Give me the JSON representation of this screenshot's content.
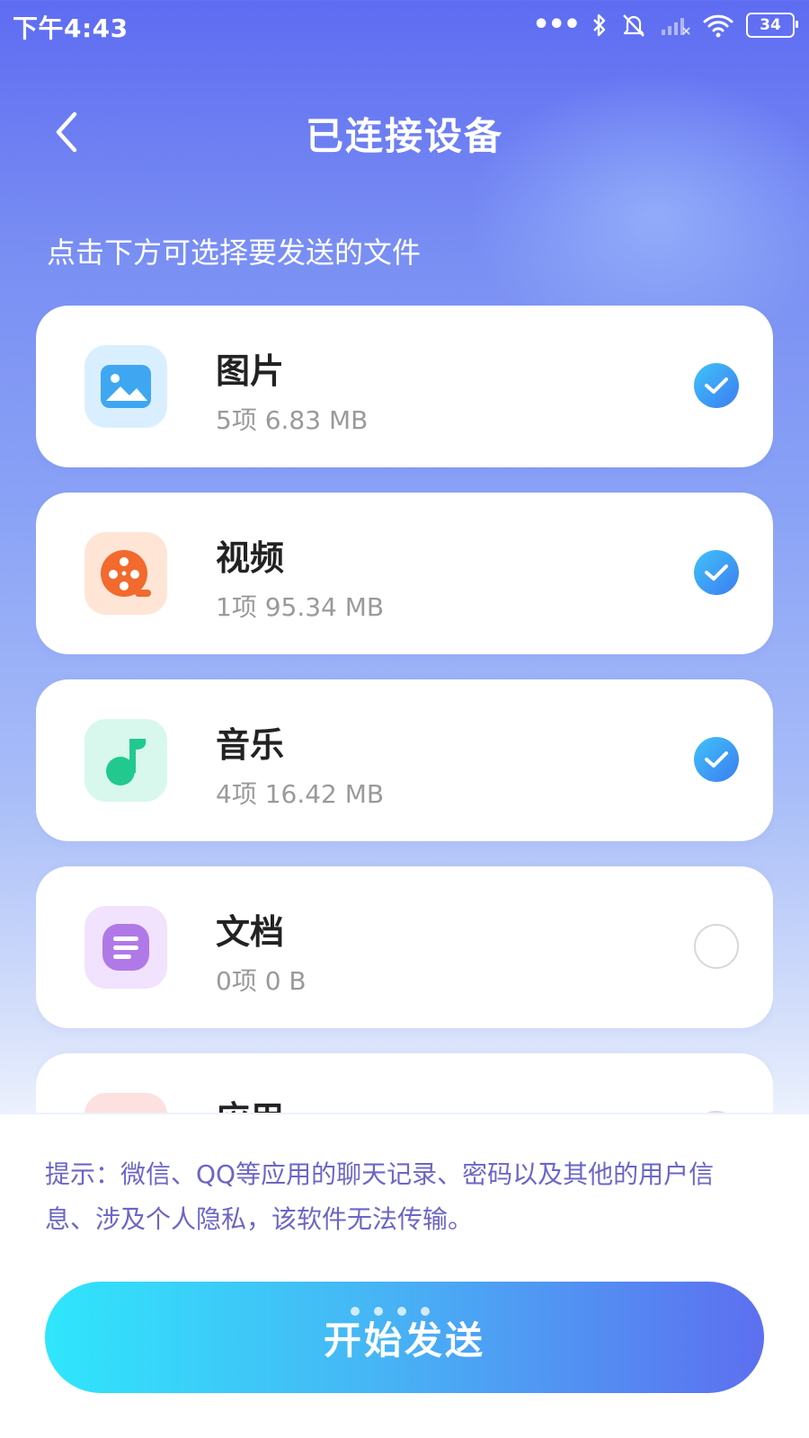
{
  "status_bar": {
    "time": "下午4:43",
    "battery": "34",
    "icons": [
      "more-dots-icon",
      "bluetooth-icon",
      "mute-icon",
      "signal-icon",
      "wifi-icon",
      "battery-icon"
    ]
  },
  "header": {
    "title": "已连接设备",
    "back_icon": "chevron-left-icon"
  },
  "instruction": "点击下方可选择要发送的文件",
  "categories": [
    {
      "name": "图片",
      "meta": "5项 6.83 MB",
      "icon": "image-icon",
      "color": "#3fa7f2",
      "selected": true
    },
    {
      "name": "视频",
      "meta": "1项 95.34 MB",
      "icon": "video-reel-icon",
      "color": "#f26a2d",
      "selected": true
    },
    {
      "name": "音乐",
      "meta": "4项 16.42 MB",
      "icon": "music-note-icon",
      "color": "#22c98f",
      "selected": true
    },
    {
      "name": "文档",
      "meta": "0项 0 B",
      "icon": "document-icon",
      "color": "#b079e8",
      "selected": false
    },
    {
      "name": "应用",
      "meta": "",
      "icon": "app-icon",
      "color": "#f04a4a",
      "selected": false
    }
  ],
  "tip": "提示：微信、QQ等应用的聊天记录、密码以及其他的用户信息、涉及个人隐私，该软件无法传输。",
  "start_button": "开始发送",
  "colors": {
    "accent_start": "#2fe6fc",
    "accent_end": "#5d6ff0",
    "tip_text": "#6b66c6"
  }
}
